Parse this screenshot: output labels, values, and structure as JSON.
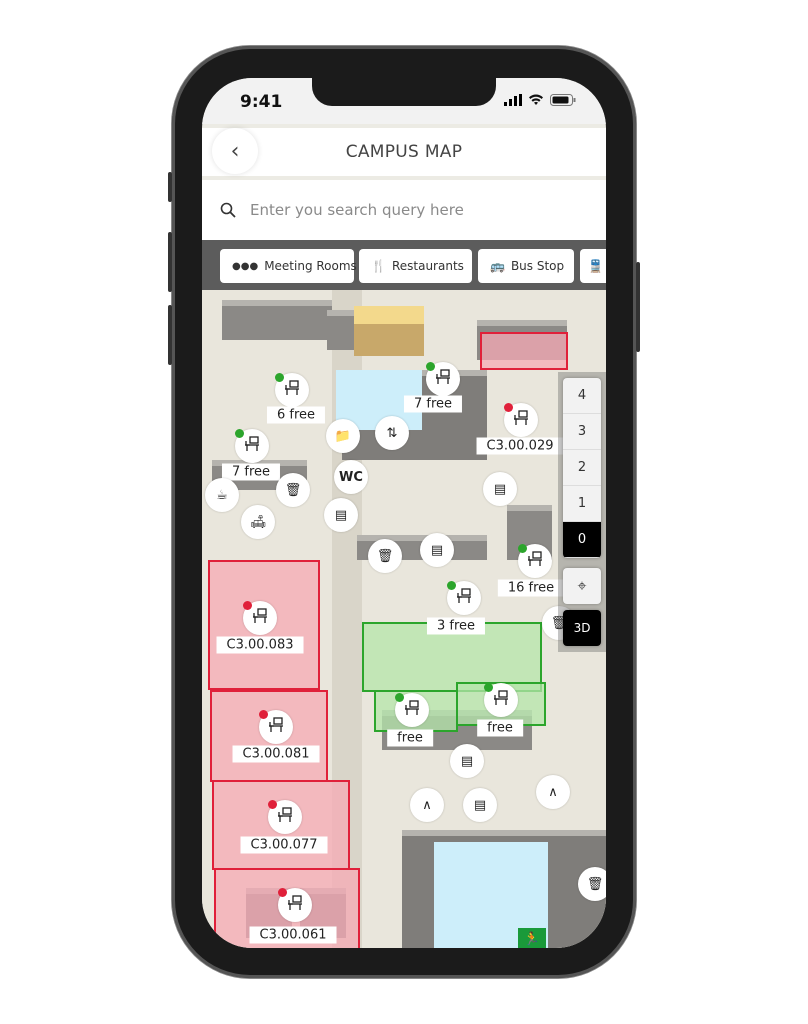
{
  "status_bar": {
    "time": "9:41"
  },
  "header": {
    "title": "CAMPUS MAP",
    "back_icon": "chevron-left-icon"
  },
  "search": {
    "placeholder": "Enter you search query here",
    "value": "",
    "icon": "search-icon"
  },
  "filters": [
    {
      "label": "Meeting Rooms",
      "icon": "meeting-rooms-icon"
    },
    {
      "label": "Restaurants",
      "icon": "fork-knife-icon"
    },
    {
      "label": "Bus Stop",
      "icon": "bus-icon"
    },
    {
      "label": "",
      "icon": "train-icon"
    }
  ],
  "floor_selector": {
    "floors": [
      "4",
      "3",
      "2",
      "1",
      "0"
    ],
    "active": "0",
    "locate_icon": "crosshair-icon",
    "view_toggle": "3D"
  },
  "colors": {
    "occupied": "#e0203a",
    "available": "#2ca52c",
    "wc": "#cdeefa",
    "highlight": "#f3d98c"
  },
  "map": {
    "workspaces": [
      {
        "label": "6 free",
        "status": "available"
      },
      {
        "label": "7 free",
        "status": "available"
      },
      {
        "label": "C3.00.029",
        "status": "occupied"
      },
      {
        "label": "7 free",
        "status": "available"
      },
      {
        "label": "16 free",
        "status": "available"
      },
      {
        "label": "3 free",
        "status": "available"
      },
      {
        "label": "C3.00.083",
        "status": "occupied"
      },
      {
        "label": "free",
        "status": "available"
      },
      {
        "label": "free",
        "status": "available"
      },
      {
        "label": "C3.00.081",
        "status": "occupied"
      },
      {
        "label": "C3.00.077",
        "status": "occupied"
      },
      {
        "label": "C3.00.061",
        "status": "occupied"
      }
    ],
    "pois": [
      {
        "icon": "folder-icon"
      },
      {
        "icon": "elevator-icon"
      },
      {
        "icon": "wc-icon",
        "label": "WC"
      },
      {
        "icon": "locker-icon"
      },
      {
        "icon": "coffee-icon"
      },
      {
        "icon": "trash-icon"
      },
      {
        "icon": "sofa-icon"
      },
      {
        "icon": "locker-icon"
      },
      {
        "icon": "trash-icon"
      },
      {
        "icon": "locker-icon"
      },
      {
        "icon": "locker-icon"
      },
      {
        "icon": "hanger-icon"
      },
      {
        "icon": "locker-icon"
      },
      {
        "icon": "hanger-icon"
      },
      {
        "icon": "trash-icon"
      },
      {
        "icon": "wc-icon",
        "label": "WC"
      },
      {
        "icon": "trash-icon"
      }
    ],
    "exit_icon": "emergency-exit-icon"
  }
}
